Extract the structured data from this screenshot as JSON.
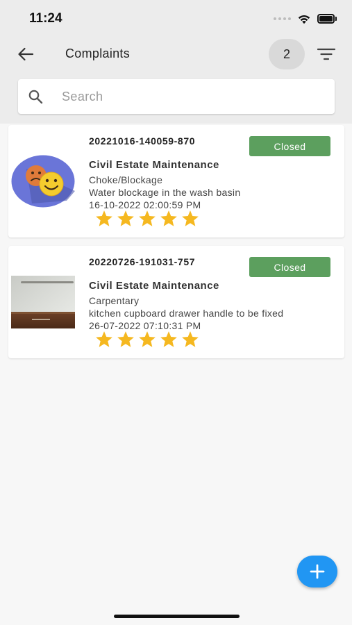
{
  "status_bar": {
    "time": "11:24"
  },
  "appbar": {
    "title": "Complaints",
    "count": "2"
  },
  "search": {
    "placeholder": "Search",
    "value": ""
  },
  "complaints": [
    {
      "ticket": "20221016-140059-870",
      "status": "Closed",
      "department": "Civil Estate Maintenance",
      "category": "Choke/Blockage",
      "description": "Water blockage in the wash basin",
      "datetime": "16-10-2022 02:00:59 PM",
      "rating": 5,
      "image": "emoji-faces-icon"
    },
    {
      "ticket": "20220726-191031-757",
      "status": "Closed",
      "department": "Civil Estate Maintenance",
      "category": "Carpentary",
      "description": "kitchen cupboard drawer handle to be fixed",
      "datetime": "26-07-2022 07:10:31 PM",
      "rating": 5,
      "image": "cupboard-photo"
    }
  ],
  "colors": {
    "status_closed": "#5c9f5e",
    "star": "#f5b820",
    "fab": "#2196f3",
    "header_bg": "#ececec"
  },
  "fab": {
    "icon": "plus-icon"
  }
}
